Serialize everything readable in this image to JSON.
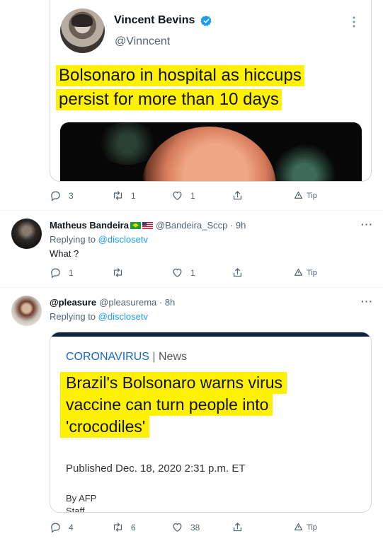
{
  "quoted_tweet": {
    "author_name": "Vincent Bevins",
    "author_handle": "@Vinncent",
    "headline_lines": [
      "Bolsonaro in hospital as hiccups",
      "persist for more than 10 days"
    ]
  },
  "tweet_actions": {
    "replies": "3",
    "retweets": "1",
    "likes": "1",
    "tip_label": "Tip"
  },
  "reply_1": {
    "name": "Matheus Bandeira",
    "handle_time": "@Bandeira_Sccp · 9h",
    "replying_prefix": "Replying to",
    "replying_to": "@disclosetv",
    "text": "What ?",
    "replies": "1",
    "retweets": "",
    "likes": "1",
    "tip_label": "Tip"
  },
  "reply_2": {
    "name": "@pleasure",
    "handle_time": "@pleasurema · 8h",
    "replying_prefix": "Replying to",
    "replying_to": "@disclosetv",
    "replies": "4",
    "retweets": "6",
    "likes": "38",
    "tip_label": "Tip",
    "article": {
      "category": "CORONAVIRUS",
      "separator": "|",
      "section": "News",
      "headline_lines": [
        "Brazil's Bolsonaro warns virus",
        "vaccine can turn people into",
        "'crocodiles'"
      ],
      "published": "Published Dec. 18, 2020 2:31 p.m. ET",
      "byline": "By AFP",
      "staff": "Staff"
    }
  },
  "more_glyph": "···",
  "colors": {
    "accent": "#1d9bf0",
    "highlight": "#fff200",
    "muted": "#536471",
    "article_category": "#1b67c4"
  },
  "icons": [
    "verified-badge-icon",
    "reply-icon",
    "retweet-icon",
    "like-icon",
    "share-icon",
    "tip-icon",
    "more-icon"
  ]
}
